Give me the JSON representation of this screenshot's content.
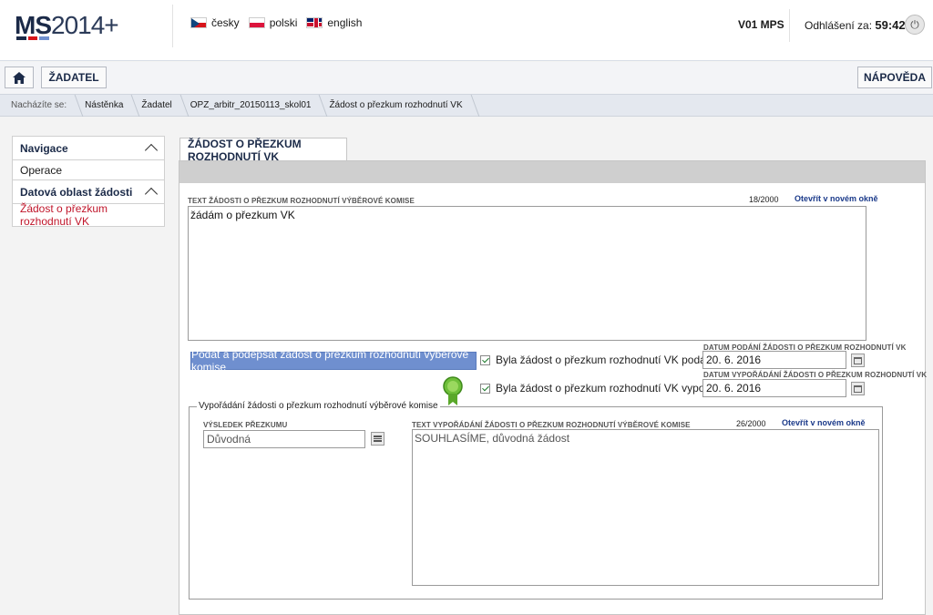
{
  "header": {
    "logo_bold": "MS",
    "logo_rest": "2014+",
    "logo_colors": [
      "#1b2a48",
      "#d7141a",
      "#6f8fcf"
    ],
    "languages": [
      {
        "label": "česky",
        "flag": "cz-flag-icon"
      },
      {
        "label": "polski",
        "flag": "pl-flag-icon"
      },
      {
        "label": "english",
        "flag": "uk-flag-icon"
      }
    ],
    "user": "V01 MPS",
    "logout_label": "Odhlášení za:",
    "logout_timer": "59:42"
  },
  "toolbar": {
    "home_icon": "home-icon",
    "zadatel_label": "ŽADATEL",
    "help_label": "NÁPOVĚDA"
  },
  "breadcrumb": {
    "label": "Nacházíte se:",
    "items": [
      "Nástěnka",
      "Žadatel",
      "OPZ_arbitr_20150113_skol01",
      "Žádost o přezkum rozhodnutí VK"
    ]
  },
  "sidebar": {
    "nav_title": "Navigace",
    "operace": "Operace",
    "data_title": "Datová oblast žádosti",
    "active_item": "Žádost o přezkum rozhodnutí VK"
  },
  "main": {
    "tab_label": "ŽÁDOST O PŘEZKUM ROZHODNUTÍ VK",
    "request_text_caption": "TEXT ŽÁDOSTI O PŘEZKUM ROZHODNUTÍ VÝBĚROVÉ KOMISE",
    "request_text_counter": "18/2000",
    "open_new_window": "Otevřít v novém okně",
    "request_text_value": "žádám o přezkum VK",
    "submit_button": "Podat a podepsat žádost o přezkum rozhodnutí výběrové komise",
    "submitted_question": "Byla žádost o přezkum rozhodnutí VK podána?",
    "resolved_question": "Byla žádost o přezkum rozhodnutí VK vypořádána?",
    "submit_date_caption": "DATUM PODÁNÍ ŽÁDOSTI O PŘEZKUM ROZHODNUTÍ VK",
    "submit_date_value": "20. 6. 2016",
    "resolve_date_caption": "DATUM VYPOŘÁDÁNÍ ŽÁDOSTI O PŘEZKUM ROZHODNUTÍ VK",
    "resolve_date_value": "20. 6. 2016",
    "fieldset_legend": "Vypořádání žádosti o přezkum rozhodnutí výběrové komise",
    "result_caption": "VÝSLEDEK PŘEZKUMU",
    "result_value": "Důvodná",
    "resolution_text_caption": "TEXT VYPOŘÁDÁNÍ ŽÁDOSTI O PŘEZKUM ROZHODNUTÍ VÝBĚROVÉ KOMISE",
    "resolution_text_counter": "26/2000",
    "resolution_open_new_window": "Otevřít v novém okně",
    "resolution_text_value": "SOUHLASÍME, důvodná žádost",
    "badge_icon": "certificate-badge-icon"
  }
}
